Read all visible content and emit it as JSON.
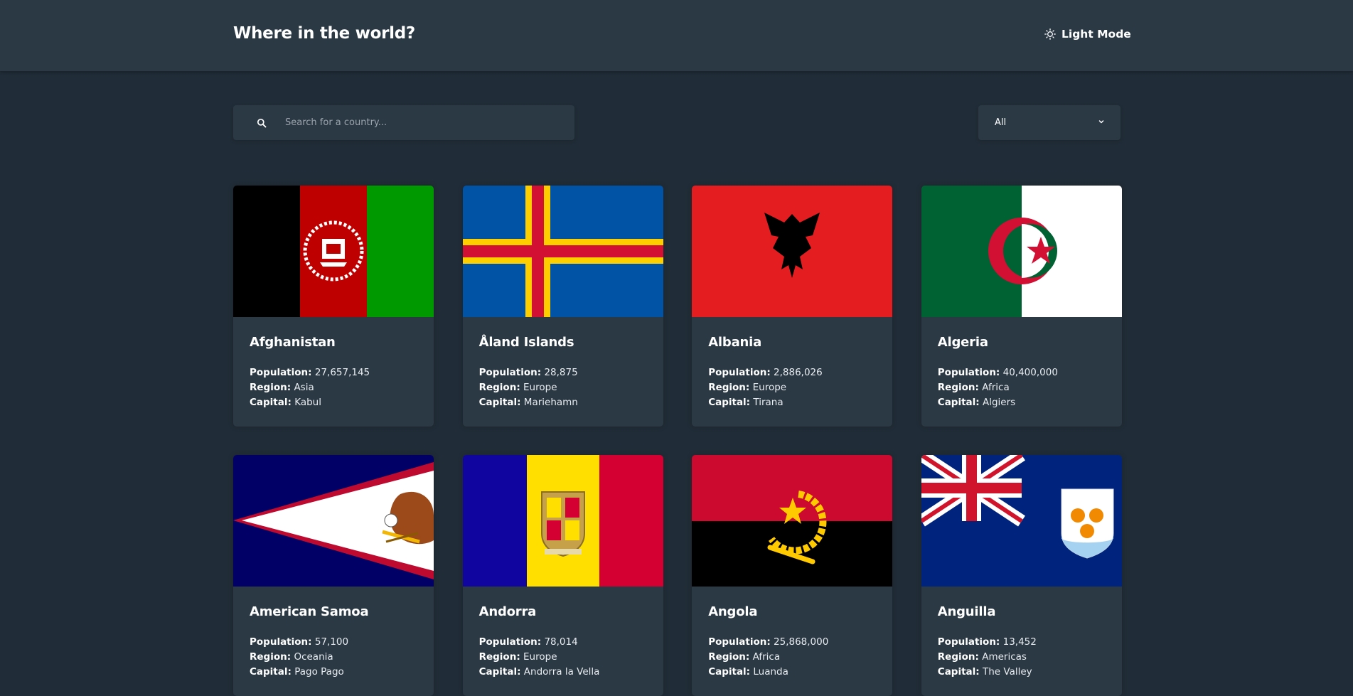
{
  "header": {
    "title": "Where in the world?",
    "mode_label": "Light Mode",
    "mode_icon": "sun-icon"
  },
  "search": {
    "placeholder": "Search for a country...",
    "icon": "search-icon"
  },
  "filter": {
    "selected": "All",
    "icon": "chevron-down-icon"
  },
  "labels": {
    "population": "Population:",
    "region": "Region:",
    "capital": "Capital:"
  },
  "countries": [
    {
      "name": "Afghanistan",
      "population": "27,657,145",
      "region": "Asia",
      "capital": "Kabul"
    },
    {
      "name": "Åland Islands",
      "population": "28,875",
      "region": "Europe",
      "capital": "Mariehamn"
    },
    {
      "name": "Albania",
      "population": "2,886,026",
      "region": "Europe",
      "capital": "Tirana"
    },
    {
      "name": "Algeria",
      "population": "40,400,000",
      "region": "Africa",
      "capital": "Algiers"
    },
    {
      "name": "American Samoa",
      "population": "57,100",
      "region": "Oceania",
      "capital": "Pago Pago"
    },
    {
      "name": "Andorra",
      "population": "78,014",
      "region": "Europe",
      "capital": "Andorra la Vella"
    },
    {
      "name": "Angola",
      "population": "25,868,000",
      "region": "Africa",
      "capital": "Luanda"
    },
    {
      "name": "Anguilla",
      "population": "13,452",
      "region": "Americas",
      "capital": "The Valley"
    }
  ]
}
